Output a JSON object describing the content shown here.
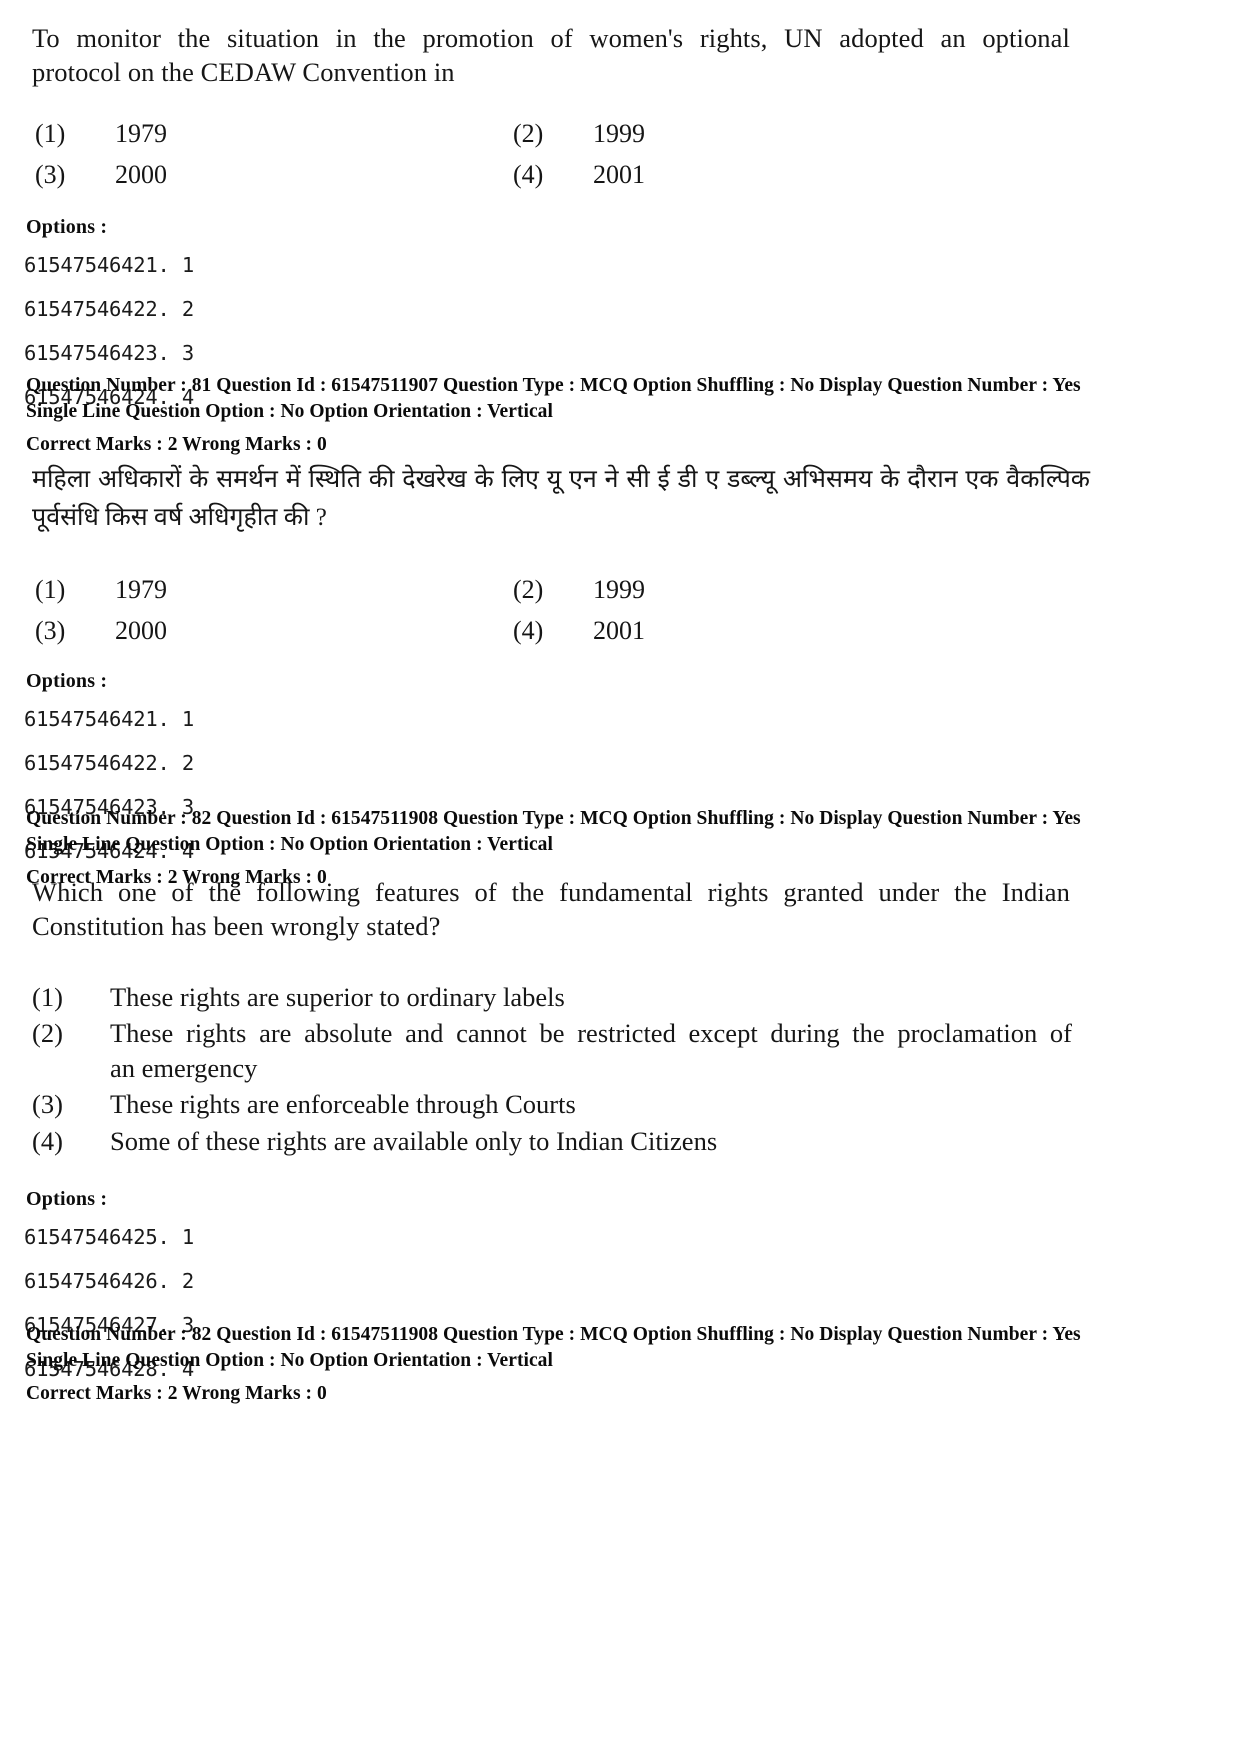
{
  "document": {
    "page_background": "#ffffff",
    "text_color": "#161616"
  },
  "questions": [
    {
      "id": "q81-en",
      "stem_line1": "To monitor the situation in the promotion of women's rights, UN adopted an optional",
      "stem_line2": "protocol on the CEDAW Convention in",
      "choices": [
        {
          "num": "(1)",
          "text": "1979"
        },
        {
          "num": "(2)",
          "text": "1999"
        },
        {
          "num": "(3)",
          "text": "2000"
        },
        {
          "num": "(4)",
          "text": "2001"
        }
      ],
      "options_label": "Options :",
      "option_ids": [
        "61547546421. 1",
        "61547546422. 2",
        "61547546423. 3",
        "61547546424. 4"
      ],
      "meta": {
        "line1": "Question Number : 81  Question Id : 61547511907  Question Type : MCQ  Option Shuffling : No  Display Question Number : Yes",
        "line2": "Single Line Question Option : No  Option Orientation : Vertical",
        "line3": "Correct Marks : 2  Wrong Marks : 0"
      }
    },
    {
      "id": "q81-hi",
      "stem_line1": "महिला अधिकारों के समर्थन में स्थिति की देखरेख के लिए यू एन ने सी ई डी ए डब्ल्यू अभिसमय के दौरान एक वैकल्पिक",
      "stem_line2": "पूर्वसंधि किस वर्ष अधिगृहीत की ?",
      "choices": [
        {
          "num": "(1)",
          "text": "1979"
        },
        {
          "num": "(2)",
          "text": "1999"
        },
        {
          "num": "(3)",
          "text": "2000"
        },
        {
          "num": "(4)",
          "text": "2001"
        }
      ],
      "options_label": "Options :",
      "option_ids": [
        "61547546421. 1",
        "61547546422. 2",
        "61547546423. 3",
        "61547546424. 4"
      ],
      "meta": {
        "line1": "Question Number : 82  Question Id : 61547511908  Question Type : MCQ  Option Shuffling : No  Display Question Number : Yes",
        "line2": "Single Line Question Option : No  Option Orientation : Vertical",
        "line3": "Correct Marks : 2  Wrong Marks : 0"
      }
    },
    {
      "id": "q82-en",
      "stem_line1": "Which one of the following features of the fundamental rights granted under the Indian",
      "stem_line2": "Constitution has been wrongly stated?",
      "choices": [
        {
          "num": "(1)",
          "text_line1": "These rights are superior to ordinary labels",
          "text_line2": ""
        },
        {
          "num": "(2)",
          "text_line1": "These rights are absolute and cannot be restricted except during the proclamation of",
          "text_line2": "an emergency"
        },
        {
          "num": "(3)",
          "text_line1": "These rights are enforceable through Courts",
          "text_line2": ""
        },
        {
          "num": "(4)",
          "text_line1": "Some of these rights are available only to Indian Citizens",
          "text_line2": ""
        }
      ],
      "options_label": "Options :",
      "option_ids": [
        "61547546425. 1",
        "61547546426. 2",
        "61547546427. 3",
        "61547546428. 4"
      ],
      "meta": {
        "line1": "Question Number : 82  Question Id : 61547511908  Question Type : MCQ  Option Shuffling : No  Display Question Number : Yes",
        "line2": "Single Line Question Option : No  Option Orientation : Vertical",
        "line3": "Correct Marks : 2  Wrong Marks : 0"
      }
    }
  ]
}
